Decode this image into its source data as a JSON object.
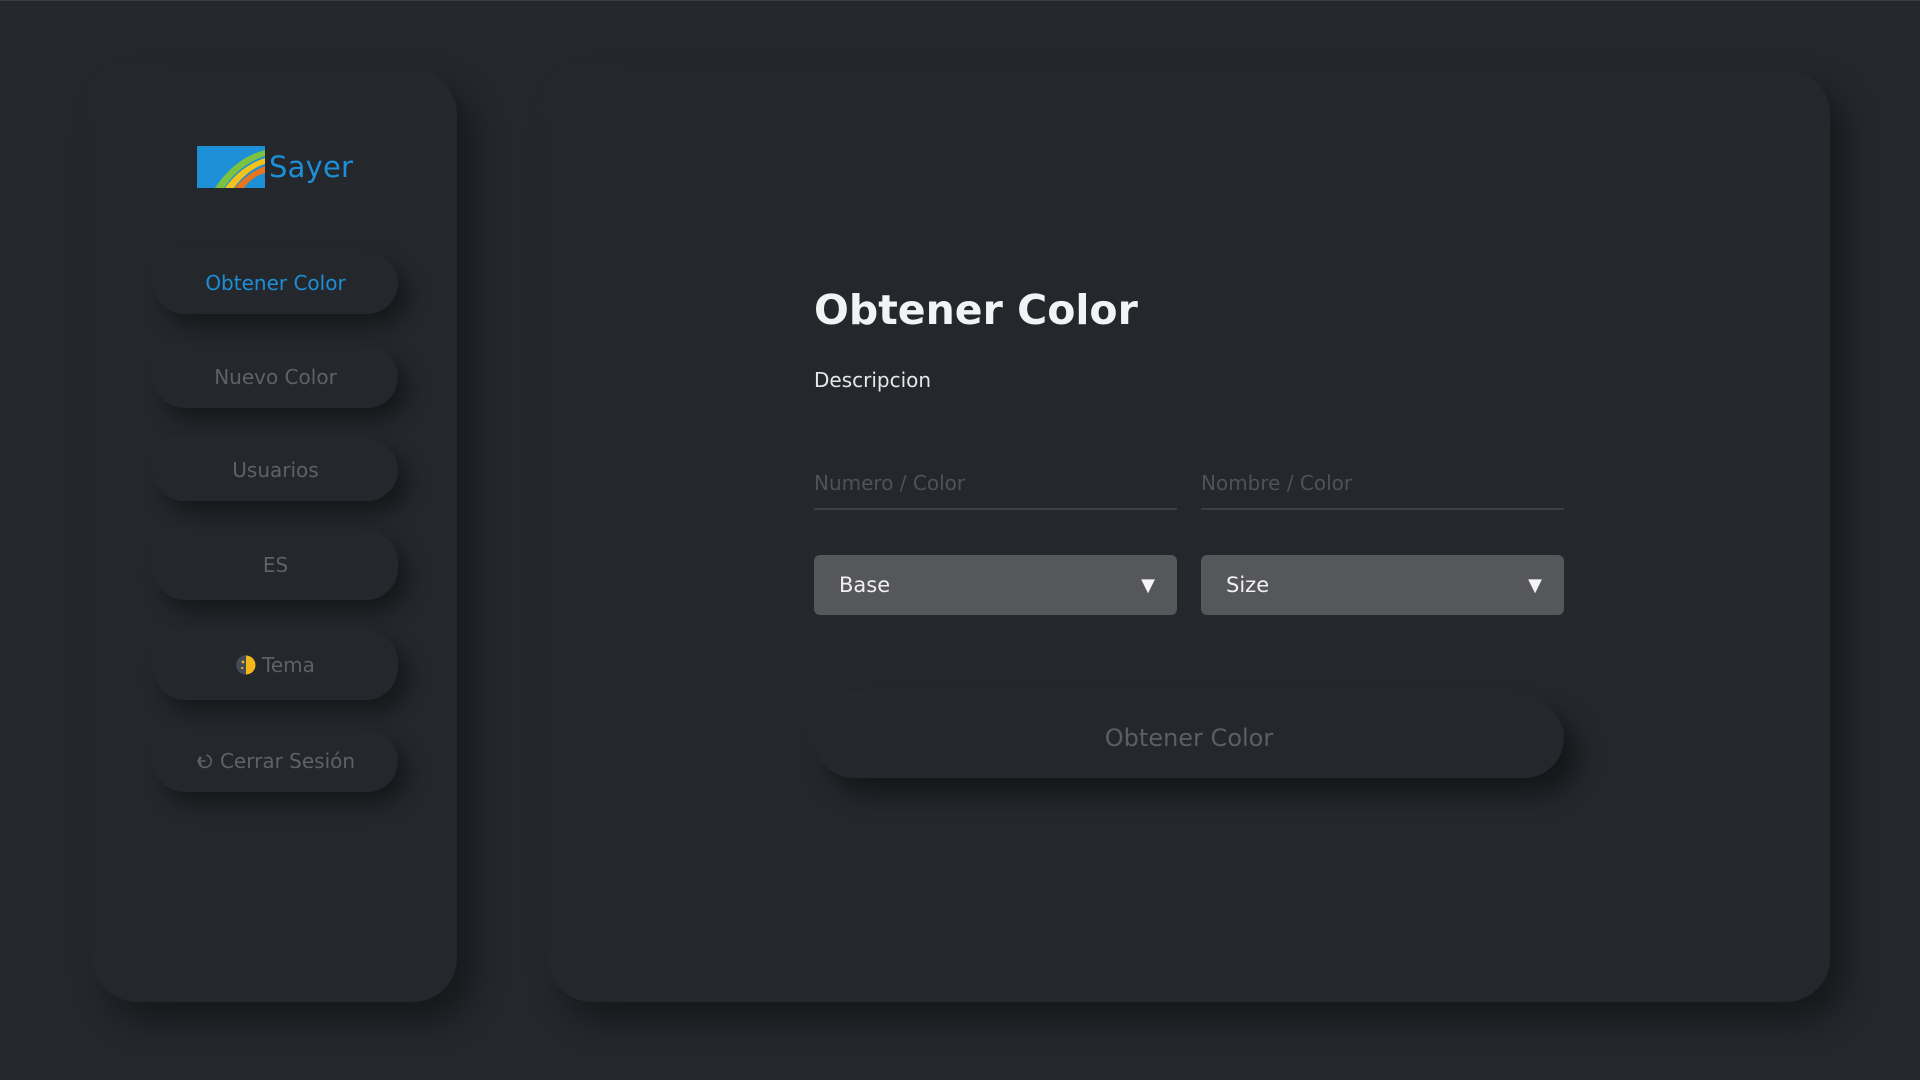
{
  "brand": {
    "name": "Sayer",
    "color": "#1c8fd6",
    "icon": "sayer-logo-icon"
  },
  "sidebar": {
    "items": [
      {
        "label": "Obtener Color",
        "active": true
      },
      {
        "label": "Nuevo Color"
      },
      {
        "label": "Usuarios"
      },
      {
        "label": "ES"
      },
      {
        "label": "Tema",
        "icon": "theme-half-moon-icon"
      },
      {
        "label": "Cerrar Sesión",
        "icon": "logout-icon"
      }
    ]
  },
  "main": {
    "title": "Obtener Color",
    "description": "Descripcion",
    "fields": {
      "numero_placeholder": "Numero / Color",
      "numero_value": "",
      "nombre_placeholder": "Nombre / Color",
      "nombre_value": ""
    },
    "selects": {
      "base": {
        "selected": "Base",
        "icon": "caret-down-icon"
      },
      "size": {
        "selected": "Size",
        "icon": "caret-down-icon"
      }
    },
    "submit_label": "Obtener Color"
  },
  "colors": {
    "background": "#24272c",
    "accent": "#1c8fd6",
    "muted_text": "#5e6166",
    "select_bg": "#56575b"
  }
}
